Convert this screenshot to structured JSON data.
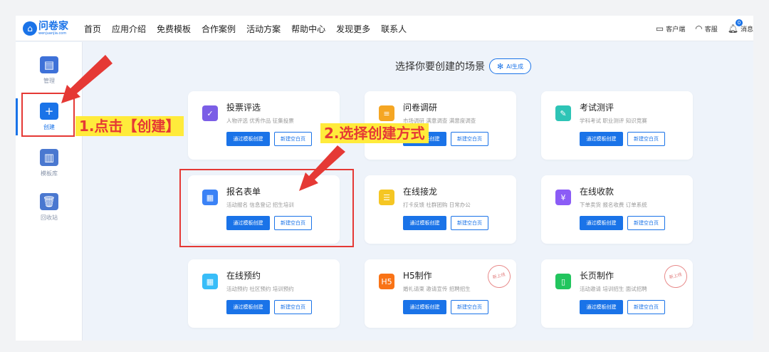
{
  "logo": {
    "name": "问卷家",
    "domain": "wenjuanjia.com"
  },
  "nav": [
    "首页",
    "应用介绍",
    "免费模板",
    "合作案例",
    "活动方案",
    "帮助中心",
    "发现更多",
    "联系人"
  ],
  "topright": {
    "client": "客户端",
    "service": "客服",
    "messages": "消息",
    "message_count": "0"
  },
  "sidebar": [
    {
      "label": "管理",
      "icon": "manage-icon",
      "color": "#3e71d8"
    },
    {
      "label": "创建",
      "icon": "create-icon",
      "color": "#1a73e8",
      "active": true
    },
    {
      "label": "模板库",
      "icon": "template-library-icon",
      "color": "#4a78d0"
    },
    {
      "label": "回收站",
      "icon": "recycle-bin-icon",
      "color": "#4a78d0"
    }
  ],
  "heading": {
    "title": "选择你要创建的场景",
    "ai_button": "AI生成"
  },
  "buttons": {
    "template": "通过模板创建",
    "blank": "新建空白页"
  },
  "cards": [
    {
      "title": "投票评选",
      "desc": "人物评选 优秀作品 征集投票",
      "icon": "vote-icon",
      "color": "#7b5ee6"
    },
    {
      "title": "问卷调研",
      "desc": "市场调研 满意调查 满意度调查",
      "icon": "survey-icon",
      "color": "#f5a623"
    },
    {
      "title": "考试测评",
      "desc": "学科考试 职业测评 知识竞赛",
      "icon": "exam-icon",
      "color": "#2ec4b6"
    },
    {
      "title": "报名表单",
      "desc": "活动报名 信息登记 招生培训",
      "icon": "signup-form-icon",
      "color": "#3b82f6"
    },
    {
      "title": "在线接龙",
      "desc": "打卡反馈 社群团购 日常办公",
      "icon": "relay-icon",
      "color": "#f5c623"
    },
    {
      "title": "在线收款",
      "desc": "下单卖货 报名收费 订单系统",
      "icon": "payment-icon",
      "color": "#8b5cf6"
    },
    {
      "title": "在线预约",
      "desc": "活动预约 社区预约 培训预约",
      "icon": "booking-icon",
      "color": "#38bdf8"
    },
    {
      "title": "H5制作",
      "desc": "婚礼请柬 邀请宣传 招聘招生",
      "icon": "h5-icon",
      "color": "#f97316",
      "stamp": "新上线"
    },
    {
      "title": "长页制作",
      "desc": "活动邀请 培训招生 面试招聘",
      "icon": "long-page-icon",
      "color": "#22c55e",
      "stamp": "新上线"
    }
  ],
  "annotations": {
    "step1": "1.点击【创建】",
    "step2": "2.选择创建方式",
    "color": "#e53935",
    "highlight": "#ffeb3b"
  }
}
